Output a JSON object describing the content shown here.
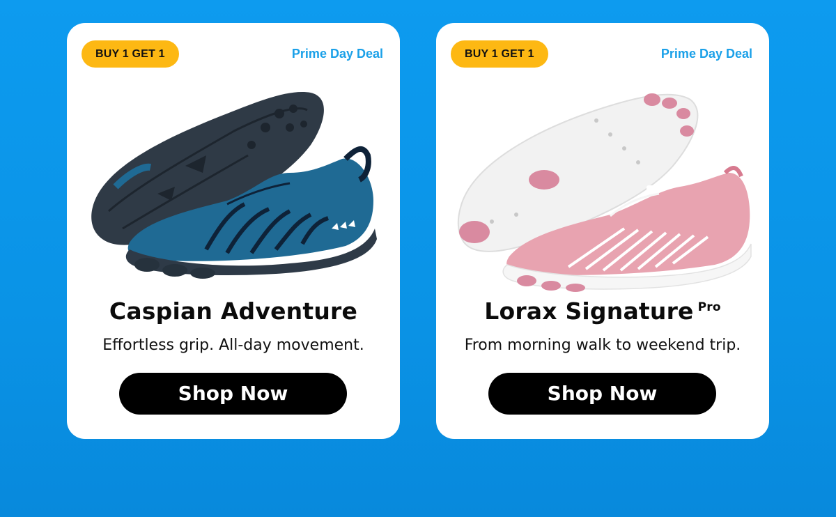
{
  "products": [
    {
      "badge": "BUY 1 GET 1",
      "deal": "Prime Day Deal",
      "name": "Caspian Adventure",
      "name_suffix": "",
      "tagline": "Effortless grip. All-day movement.",
      "cta": "Shop Now",
      "colors": {
        "upper": "#1f6a94",
        "sole": "#2e3a47",
        "accent": "#0e2238"
      }
    },
    {
      "badge": "BUY 1 GET 1",
      "deal": "Prime Day Deal",
      "name": "Lorax Signature",
      "name_suffix": "Pro",
      "tagline": "From morning walk to weekend trip.",
      "cta": "Shop Now",
      "colors": {
        "upper": "#e8a3b0",
        "sole": "#f4f4f4",
        "accent": "#d77a8f"
      }
    }
  ],
  "theme": {
    "background": "#0d9bef",
    "badge": "#fdb813",
    "deal_text": "#1aa0e8"
  }
}
